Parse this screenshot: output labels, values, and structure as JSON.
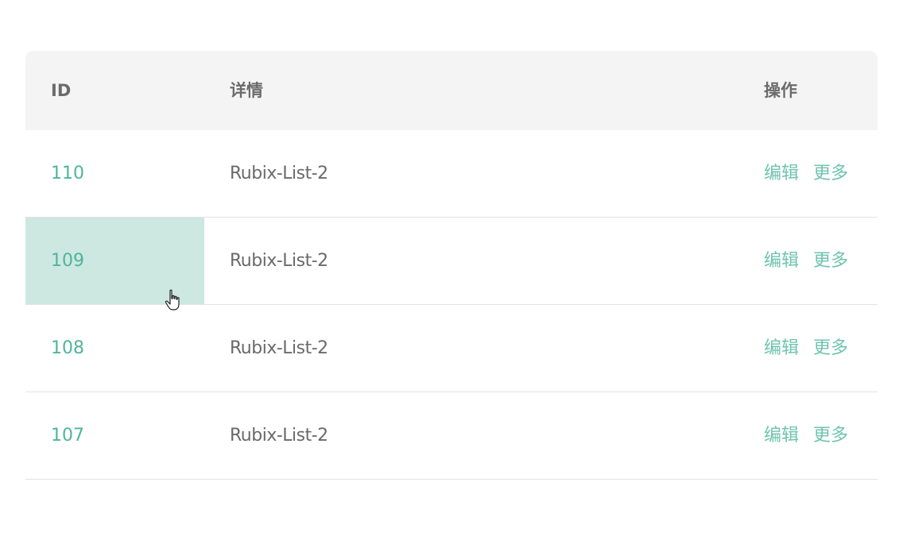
{
  "table": {
    "headers": {
      "id": "ID",
      "detail": "详情",
      "ops": "操作"
    },
    "rows": [
      {
        "id": "110",
        "detail": "Rubix-List-2",
        "edit": "编辑",
        "more": "更多",
        "hovered": false
      },
      {
        "id": "109",
        "detail": "Rubix-List-2",
        "edit": "编辑",
        "more": "更多",
        "hovered": true
      },
      {
        "id": "108",
        "detail": "Rubix-List-2",
        "edit": "编辑",
        "more": "更多",
        "hovered": false
      },
      {
        "id": "107",
        "detail": "Rubix-List-2",
        "edit": "编辑",
        "more": "更多",
        "hovered": false
      }
    ]
  },
  "colors": {
    "accent": "#4fb59a",
    "hover_background": "#cce8e0",
    "header_background": "#f4f4f4"
  },
  "cursor": {
    "icon": "hand-pointer-icon"
  }
}
